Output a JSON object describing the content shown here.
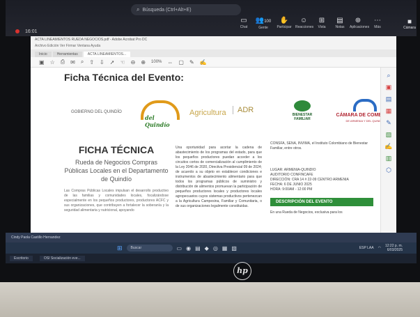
{
  "teams": {
    "search_placeholder": "Búsqueda (Ctrl+Alt+E)",
    "meeting_time": "16:01",
    "tools": [
      {
        "label": "Chat",
        "icon": "chat-icon"
      },
      {
        "label": "Gente",
        "icon": "people-icon",
        "badge": "100"
      },
      {
        "label": "Participar",
        "icon": "raise-hand-icon"
      },
      {
        "label": "Reacciones",
        "icon": "reactions-icon"
      },
      {
        "label": "Vista",
        "icon": "view-icon"
      },
      {
        "label": "Notas",
        "icon": "notes-icon"
      },
      {
        "label": "Aplicaciones",
        "icon": "apps-icon"
      },
      {
        "label": "Más",
        "icon": "more-icon"
      },
      {
        "label": "Cámara",
        "icon": "camera-icon"
      }
    ]
  },
  "pdf": {
    "window_title": "ACTA LINEAMIENTOS RUEDA NEGOCIOS.pdf - Adobe Acrobat Pro DC",
    "menu": "Archivo  Edición  Ver  Firmar  Ventana  Ayuda",
    "tabs": [
      "Inicio",
      "Herramientas",
      "ACTA LINEAMIENTOS..."
    ],
    "zoom": "100%",
    "heading": "Ficha Técnica del Evento:",
    "logos": {
      "gobierno": "GOBIERNO DEL QUINDÍO",
      "mcq": "del Quindío",
      "agricultura": "Agricultura",
      "adr": "ADR",
      "bienestar": "BIENESTAR FAMILIAR",
      "camara": "CÁMARA DE COMERCIO",
      "camara_sub": "DE ARMENIA Y DEL QUINDÍO"
    },
    "ficha_title": "FICHA TÉCNICA",
    "ficha_sub": "Rueda de Negocios Compras Públicas Locales en el Departamento de Quindío",
    "col1_body": "Las Compras Públicas Locales impulsan el desarrollo productivo de las familias y comunidades locales, focalizándose especialmente en los pequeños productores, productores ACFC y sus organizaciones, que contribuyen a fortalecer la soberanía y la seguridad alimentaria y nutricional, apoyando",
    "col2_body": "Una oportunidad para acortar la cadena de abastecimiento de los programas del estado, para que los pequeños productores puedan acceder a los circuitos cortos de comercialización al cumplimiento de la Ley 2046 de 2020, Directiva Presidencial 09 de 2024; de acuerdo a su objeto en establecer condiciones e instrumentos de abastecimiento alimentario para que todos los programas públicos de suministro y distribución de alimentos promuevan la participación de pequeños productores locales y productores locales agropecuarios cuyos sistemas productivos pertenezcan a la Agricultura Campesina, Familiar y Comunitaria, o de sus organizaciones legalmente constituidas.",
    "col3_top": "CONSFA, SENA, INVIMA, el Instituto Colombiano de Bienestar Familiar, entre otros.",
    "col3_info": [
      "LUGAR: ARMENIA-QUINDIO",
      "AUDITORIO CONFINCAFE",
      "DIRECCIÓN: CRA 14 # 22-09 CENTRO ARMENIA",
      "FECHA: 6 DE JUNIO 2025",
      "HORA: 9:00AM - 12:00 PM"
    ],
    "desc_button": "DESCRIPCIÓN DEL EVENTO",
    "col3_after": "En una Rueda de Negocios, exclusiva para los"
  },
  "taskbar": {
    "banner": "Cindy Paola Castillo Hernandez",
    "search": "Buscar",
    "lang": "ESP LAA",
    "time": "12:22 p. m.",
    "date": "6/03/2025",
    "windows": [
      "Escritorio",
      "OSI Socialización eve..."
    ]
  },
  "laptop_brand": "hp"
}
